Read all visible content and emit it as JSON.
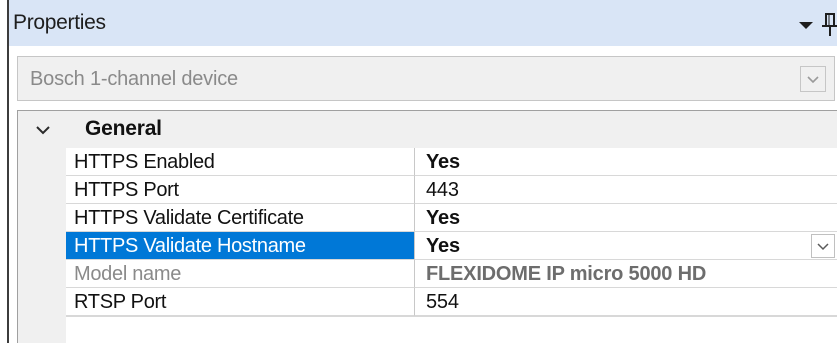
{
  "panel": {
    "title": "Properties",
    "dropdown_icon": "caret-down-icon",
    "pin_icon": "pin-icon"
  },
  "object_selector": {
    "value": "Bosch 1-channel device",
    "arrow_icon": "chevron-down-icon"
  },
  "category": {
    "label": "General",
    "expand_icon": "chevron-down-icon",
    "expanded": true
  },
  "properties": [
    {
      "name": "HTTPS Enabled",
      "value": "Yes",
      "bold": true
    },
    {
      "name": "HTTPS Port",
      "value": "443",
      "bold": false
    },
    {
      "name": "HTTPS Validate Certificate",
      "value": "Yes",
      "bold": true
    },
    {
      "name": "HTTPS Validate Hostname",
      "value": "Yes",
      "bold": true,
      "selected": true
    },
    {
      "name": "Model name",
      "value": "FLEXIDOME IP micro 5000 HD",
      "bold": true,
      "readonly": true
    },
    {
      "name": "RTSP Port",
      "value": "554",
      "bold": false
    }
  ],
  "colors": {
    "titlebar": "#d9e5f6",
    "selection": "#0078d7",
    "gutter": "#f0f0f0"
  }
}
